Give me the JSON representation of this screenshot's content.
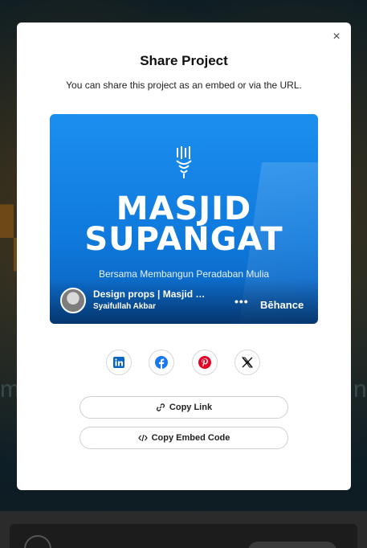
{
  "modal": {
    "title": "Share Project",
    "subtitle": "You can share this project as an embed or via the URL.",
    "close_icon": "×"
  },
  "preview": {
    "headline_1": "MASJID",
    "headline_2": "SUPANGAT",
    "tagline": "Bersama Membangun Peradaban Mulia",
    "project_title": "Design props | Masjid …",
    "author": "Syaifullah Akbar",
    "more_label": "•••",
    "brand": "Bēhance",
    "accent_color": "#1b8ff0"
  },
  "share": [
    {
      "name": "linkedin",
      "icon": "linkedin-icon",
      "color": "#0a66c2"
    },
    {
      "name": "facebook",
      "icon": "facebook-icon",
      "color": "#1877f2"
    },
    {
      "name": "pinterest",
      "icon": "pinterest-icon",
      "color": "#e60023"
    },
    {
      "name": "x",
      "icon": "x-icon",
      "color": "#111111"
    }
  ],
  "actions": {
    "copy_link": "Copy Link",
    "copy_embed": "Copy Embed Code"
  }
}
